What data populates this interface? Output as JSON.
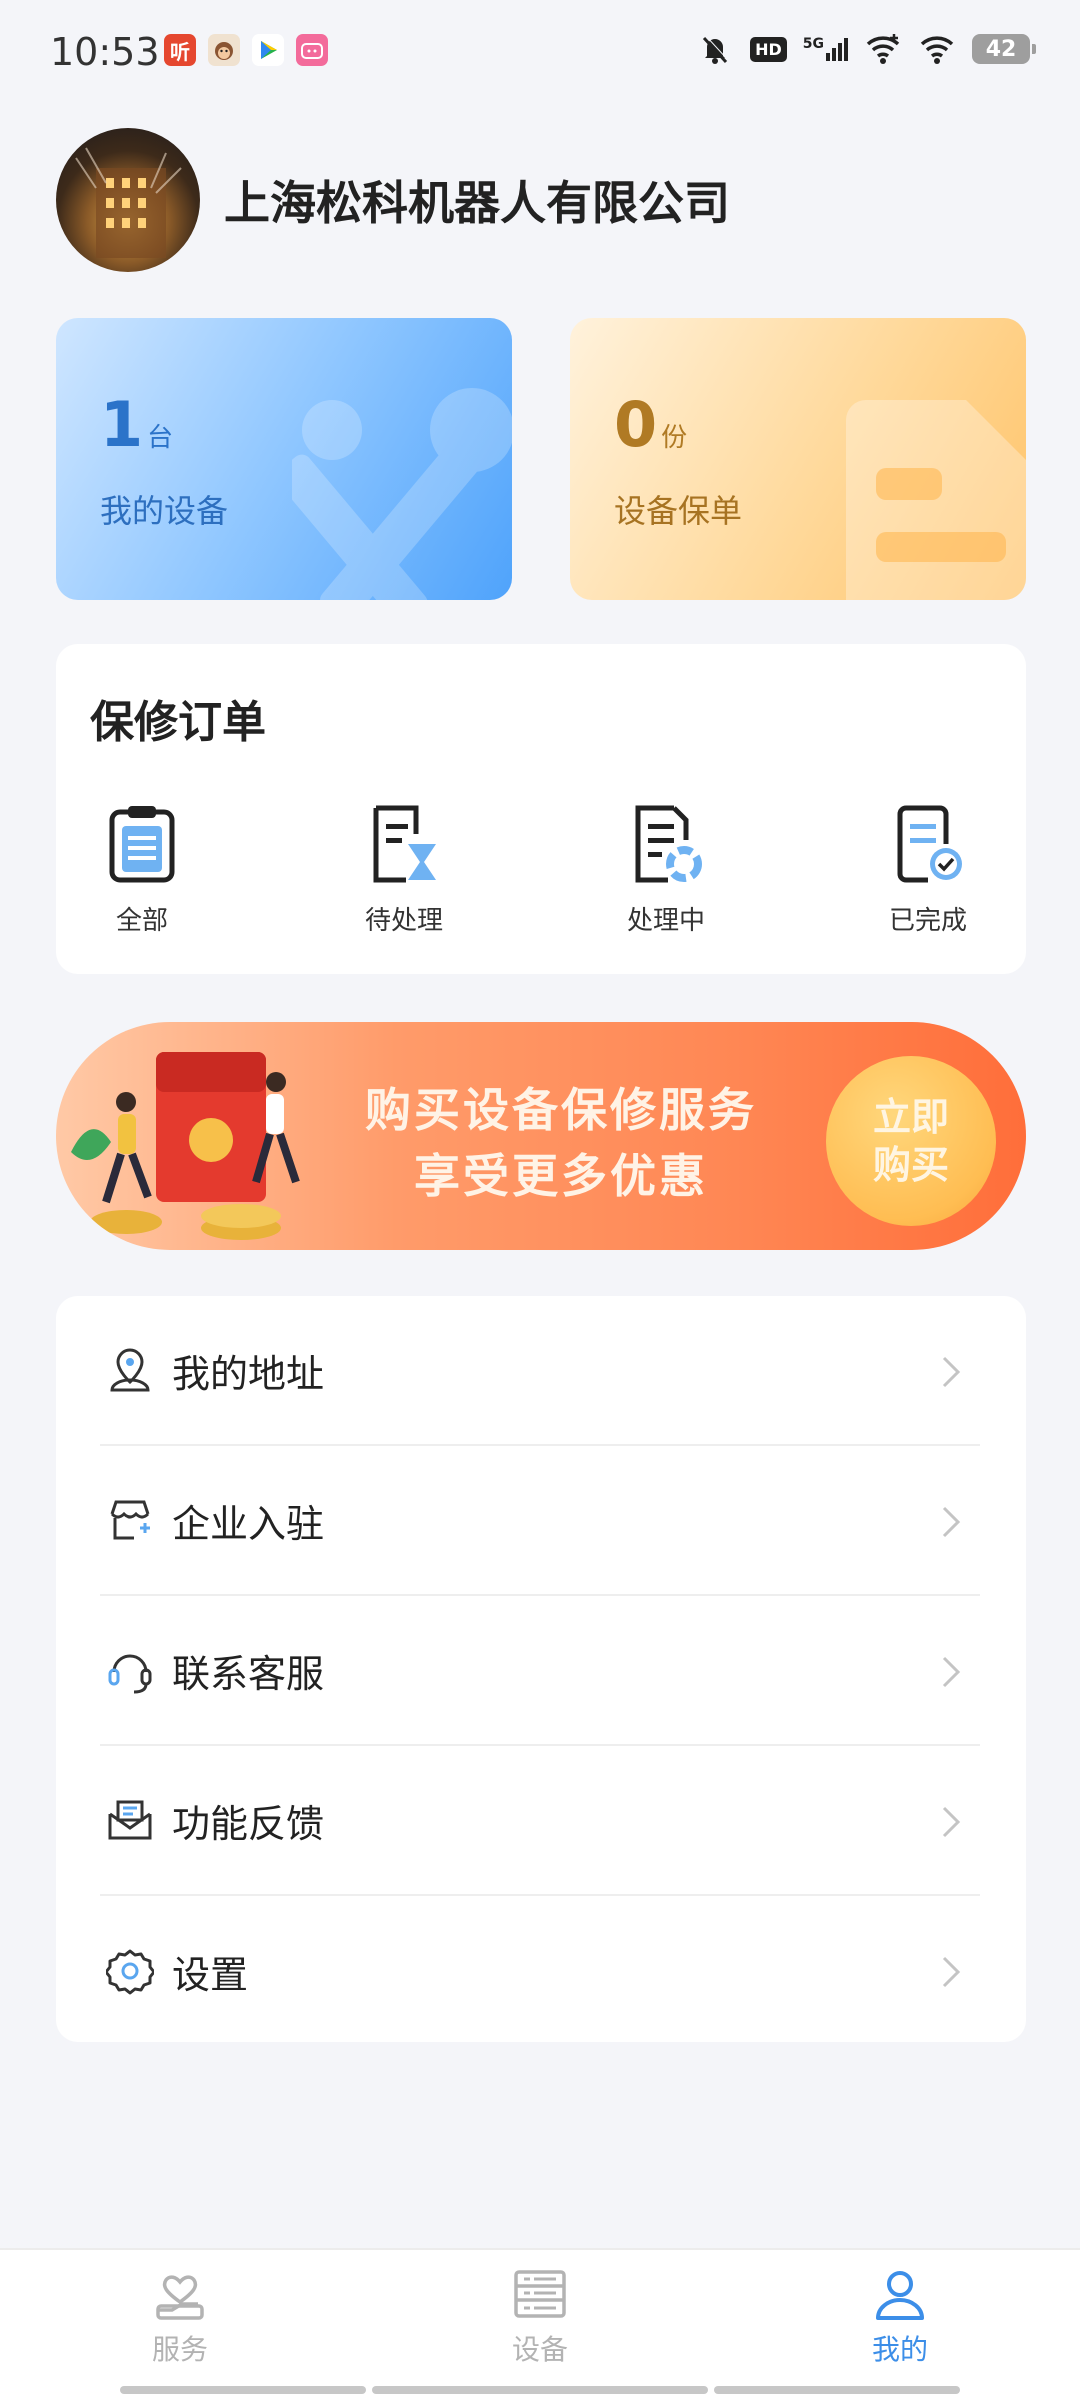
{
  "status_bar": {
    "time": "10:53",
    "battery": "42",
    "hd": "HD",
    "network": "5G",
    "apps": [
      {
        "icon": "ting-app-icon",
        "text": "听",
        "color": "#e5472f"
      },
      {
        "icon": "monkey-app-icon",
        "text": "",
        "color": "#f0e2d0"
      },
      {
        "icon": "play-app-icon",
        "text": "",
        "color": "#ffffff"
      },
      {
        "icon": "bilibili-app-icon",
        "text": "",
        "color": "#f36b9b"
      }
    ]
  },
  "profile": {
    "company_name": "上海松科机器人有限公司"
  },
  "stats": {
    "devices": {
      "count": "1",
      "unit": "台",
      "label": "我的设备"
    },
    "policies": {
      "count": "0",
      "unit": "份",
      "label": "设备保单"
    }
  },
  "repair_orders": {
    "title": "保修订单",
    "items": [
      {
        "label": "全部",
        "icon": "clipboard-list-icon"
      },
      {
        "label": "待处理",
        "icon": "doc-hourglass-icon"
      },
      {
        "label": "处理中",
        "icon": "doc-processing-icon"
      },
      {
        "label": "已完成",
        "icon": "doc-check-icon"
      }
    ]
  },
  "banner": {
    "line1": "购买设备保修服务",
    "line2": "享受更多优惠",
    "button_line1": "立即",
    "button_line2": "购买"
  },
  "menu": {
    "items": [
      {
        "label": "我的地址",
        "icon": "location-user-icon"
      },
      {
        "label": "企业入驻",
        "icon": "store-icon"
      },
      {
        "label": "联系客服",
        "icon": "headset-icon"
      },
      {
        "label": "功能反馈",
        "icon": "mail-feedback-icon"
      },
      {
        "label": "设置",
        "icon": "gear-icon"
      }
    ]
  },
  "bottom_nav": {
    "tabs": [
      {
        "label": "服务",
        "icon": "heart-hand-icon",
        "active": false
      },
      {
        "label": "设备",
        "icon": "server-icon",
        "active": false
      },
      {
        "label": "我的",
        "icon": "user-icon",
        "active": true
      }
    ]
  },
  "colors": {
    "accent_blue": "#3c8ee8",
    "background": "#f4f5f9",
    "banner_orange": "#ff8754"
  }
}
